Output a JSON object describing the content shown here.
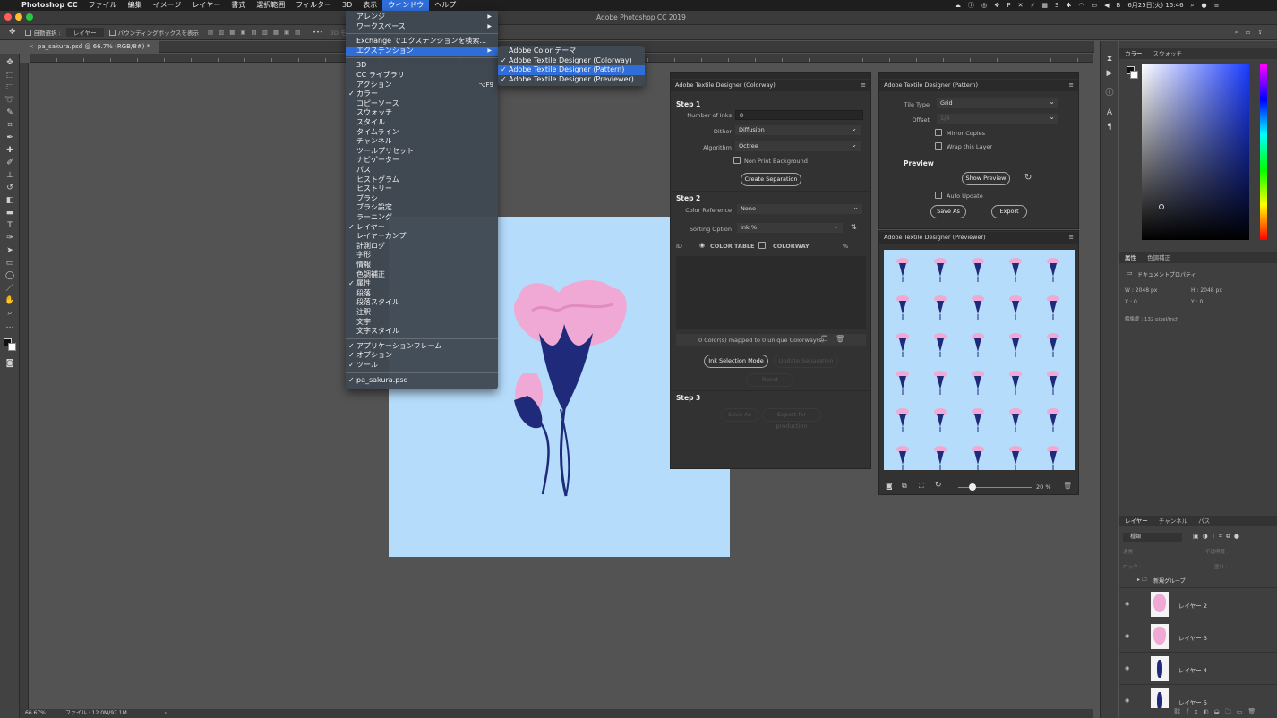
{
  "menubar": {
    "app": "Photoshop CC",
    "items": [
      "ファイル",
      "編集",
      "イメージ",
      "レイヤー",
      "書式",
      "選択範囲",
      "フィルター",
      "3D",
      "表示",
      "ウィンドウ",
      "ヘルプ"
    ],
    "selected": "ウィンドウ",
    "clock": "6月25日(火)  15:46"
  },
  "window_title": "Adobe Photoshop CC 2019",
  "options": {
    "auto_select": "自動選択 :",
    "layer_select": "レイヤー",
    "bbox": "バウンディングボックスを表示",
    "mode3d": "3D モード :"
  },
  "doc_tab": "pa_sakura.psd @ 66.7% (RGB/8#) *",
  "status": {
    "zoom": "66.67%",
    "file": "ファイル : 12.0M/97.1M"
  },
  "window_menu": {
    "items": [
      {
        "label": "アレンジ",
        "arrow": "▶"
      },
      {
        "label": "ワークスペース",
        "arrow": "▶"
      },
      {
        "label": "Exchange でエクステンションを検索..."
      },
      {
        "label": "エクステンション",
        "arrow": "▶",
        "highlight": true
      },
      {
        "label": "3D"
      },
      {
        "label": "CC ライブラリ"
      },
      {
        "label": "アクション",
        "shortcut": "⌥F9"
      },
      {
        "label": "カラー",
        "check": "✓"
      },
      {
        "label": "コピーソース"
      },
      {
        "label": "スウォッチ"
      },
      {
        "label": "スタイル"
      },
      {
        "label": "タイムライン"
      },
      {
        "label": "チャンネル"
      },
      {
        "label": "ツールプリセット"
      },
      {
        "label": "ナビゲーター"
      },
      {
        "label": "パス"
      },
      {
        "label": "ヒストグラム"
      },
      {
        "label": "ヒストリー"
      },
      {
        "label": "ブラシ"
      },
      {
        "label": "ブラシ設定"
      },
      {
        "label": "ラーニング"
      },
      {
        "label": "レイヤー",
        "check": "✓"
      },
      {
        "label": "レイヤーカンプ"
      },
      {
        "label": "計測ログ"
      },
      {
        "label": "字形"
      },
      {
        "label": "情報"
      },
      {
        "label": "色調補正"
      },
      {
        "label": "属性",
        "check": "✓"
      },
      {
        "label": "段落"
      },
      {
        "label": "段落スタイル"
      },
      {
        "label": "注釈"
      },
      {
        "label": "文字"
      },
      {
        "label": "文字スタイル"
      },
      {
        "label": "アプリケーションフレーム",
        "check": "✓"
      },
      {
        "label": "オプション",
        "check": "✓"
      },
      {
        "label": "ツール",
        "check": "✓"
      },
      {
        "label": "pa_sakura.psd",
        "check": "✓"
      }
    ]
  },
  "submenu": {
    "items": [
      {
        "label": "Adobe Color テーマ"
      },
      {
        "label": "Adobe Textile Designer (Colorway)",
        "check": "✓"
      },
      {
        "label": "Adobe Textile Designer (Pattern)",
        "check": "✓",
        "highlight": true
      },
      {
        "label": "Adobe Textile Designer (Previewer)",
        "check": "✓"
      }
    ]
  },
  "colorway": {
    "title": "Adobe Textile Designer (Colorway)",
    "step1": "Step 1",
    "num_inks_label": "Number of Inks",
    "num_inks": "8",
    "dither_label": "Dither",
    "dither": "Diffusion",
    "algorithm_label": "Algorithm",
    "algorithm": "Octree",
    "nonprint": "Non Print Background",
    "create_sep": "Create Separation",
    "step2": "Step 2",
    "color_ref_label": "Color Reference",
    "color_ref": "None",
    "sorting_label": "Sorting Option",
    "sorting": "Ink %",
    "col_id": "ID",
    "col_table": "COLOR TABLE",
    "col_colorway": "COLORWAY",
    "col_pct": "%",
    "mapped": "0 Color(s) mapped to 0 unique Colorway(s)",
    "ink_sel": "Ink Selection Mode",
    "update_sep": "Update Separation",
    "reset": "Reset",
    "step3": "Step 3",
    "save_as": "Save As",
    "export_prod": "Export for production"
  },
  "pattern": {
    "title": "Adobe Textile Designer (Pattern)",
    "tile_label": "Tile Type",
    "tile": "Grid",
    "offset_label": "Offset",
    "offset": "1/4",
    "mirror": "Mirror Copies",
    "wrap": "Wrap this Layer",
    "preview": "Preview",
    "show_preview": "Show Preview",
    "auto_update": "Auto Update",
    "save_as": "Save As",
    "export": "Export"
  },
  "previewer": {
    "title": "Adobe Textile Designer (Previewer)",
    "zoom": "20 %",
    "zoom_level": 0.2
  },
  "color_panel": {
    "tabs": [
      "カラー",
      "スウォッチ"
    ]
  },
  "props_panel": {
    "tabs": [
      "属性",
      "色調補正"
    ],
    "doc": "ドキュメントプロパティ",
    "w": "W : 2048 px",
    "h": "H : 2048 px",
    "x": "X : 0",
    "y": "Y : 0",
    "res": "解像度 : 132 pixel/inch"
  },
  "layers_panel": {
    "tabs": [
      "レイヤー",
      "チャンネル",
      "パス"
    ],
    "kind": "種類",
    "mode": "通常",
    "opacity": "不透明度 :",
    "lock": "ロック :",
    "fill": "塗り :",
    "group": "新規グループ",
    "layers": [
      "レイヤー 2",
      "レイヤー 3",
      "レイヤー 4",
      "レイヤー 5"
    ]
  },
  "colors": {
    "canvas_bg": "#b5dcfb",
    "menu_highlight": "#2f6ed9",
    "petal": "#f0a9d4",
    "stem": "#1f2b7a"
  }
}
